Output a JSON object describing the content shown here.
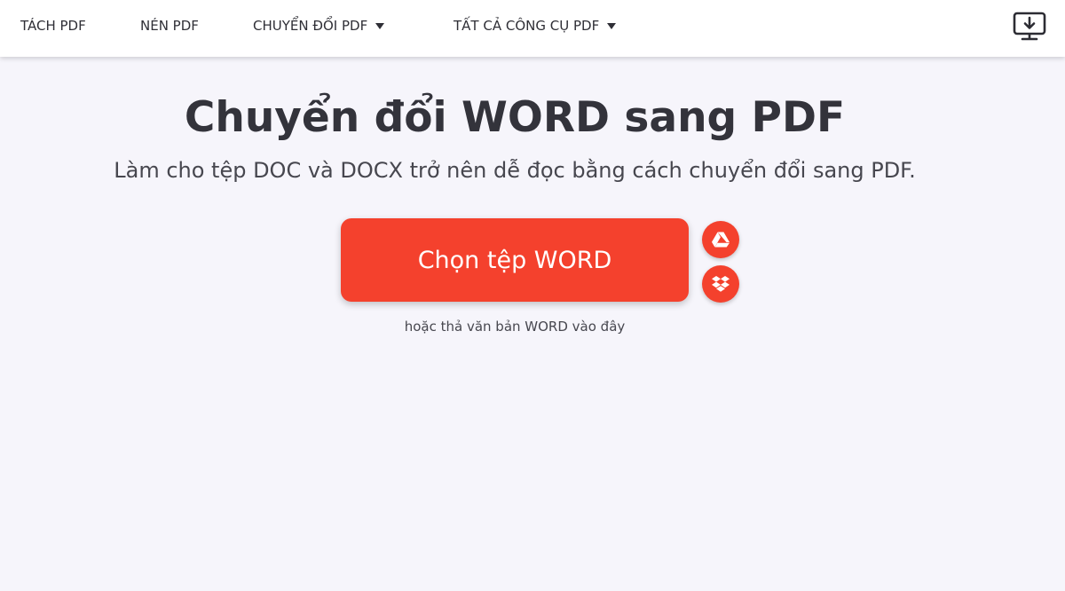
{
  "nav": {
    "items": [
      {
        "label": "TÁCH PDF",
        "has_dropdown": false
      },
      {
        "label": "NÉN PDF",
        "has_dropdown": false
      },
      {
        "label": "CHUYỂN ĐỔI PDF",
        "has_dropdown": true
      },
      {
        "label": "TẤT CẢ CÔNG CỤ PDF",
        "has_dropdown": true
      }
    ],
    "desktop_icon": "desktop-download-icon"
  },
  "hero": {
    "title": "Chuyển đổi WORD sang PDF",
    "subtitle": "Làm cho tệp DOC và DOCX trở nên dễ đọc bằng cách chuyển đổi sang PDF."
  },
  "upload": {
    "button_label": "Chọn tệp WORD",
    "drop_hint": "hoặc thả văn bản WORD vào đây",
    "cloud_icons": [
      "google-drive-icon",
      "dropbox-icon"
    ]
  },
  "colors": {
    "accent": "#f4412d",
    "background": "#f6f5fb",
    "header_bg": "#ffffff",
    "text": "#33333b"
  }
}
